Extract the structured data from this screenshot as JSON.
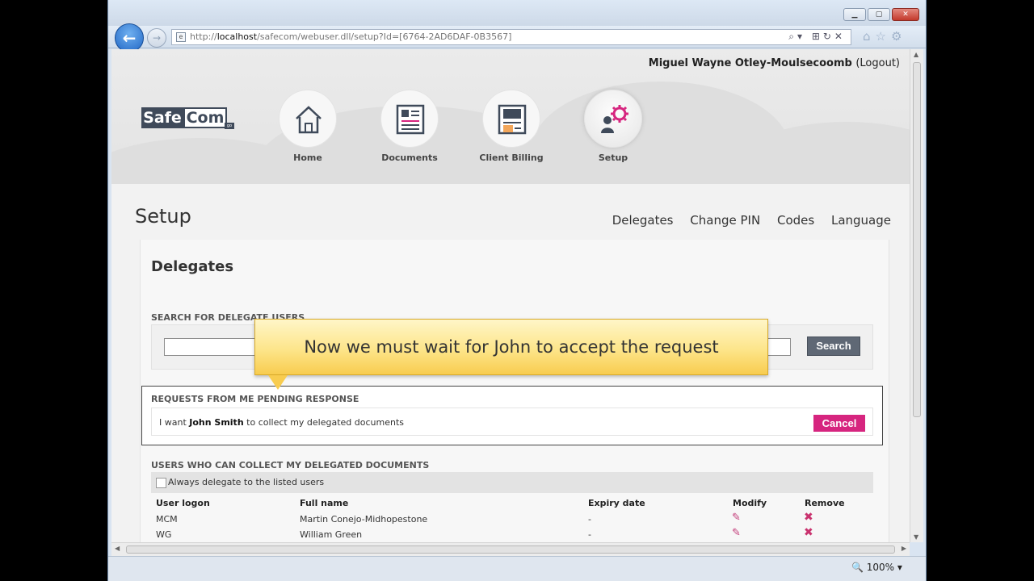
{
  "browser": {
    "url_prefix": "http://",
    "url_host": "localhost",
    "url_path": "/safecom/webuser.dll/setup?Id=[6764-2AD6DAF-0B3567]",
    "zoom": "100%",
    "address_tools": "⌕▾ ⊞↻✕",
    "chrome_icons": "⌂☆⚙"
  },
  "header": {
    "user_name": "Miguel Wayne Otley-Moulsecoomb",
    "logout": "(Logout)"
  },
  "logo": {
    "part1": "Safe",
    "part2": "Com",
    "badge": "go"
  },
  "nav": {
    "home": "Home",
    "documents": "Documents",
    "client_billing": "Client Billing",
    "setup": "Setup"
  },
  "page": {
    "title": "Setup",
    "subnav": [
      "Delegates",
      "Change PIN",
      "Codes",
      "Language"
    ]
  },
  "delegates": {
    "title": "Delegates",
    "search_label": "SEARCH FOR DELEGATE USERS",
    "search_button": "Search",
    "pending_label": "REQUESTS FROM ME PENDING RESPONSE",
    "pending_pre": "I want ",
    "pending_name": "John Smith",
    "pending_post": " to collect my delegated documents",
    "cancel_button": "Cancel",
    "users_label": "USERS WHO CAN COLLECT MY DELEGATED DOCUMENTS",
    "always_label": "Always delegate to the listed users",
    "columns": [
      "User logon",
      "Full name",
      "Expiry date",
      "Modify",
      "Remove"
    ],
    "rows": [
      {
        "logon": "MCM",
        "name": "Martin Conejo-Midhopestone",
        "expiry": "-"
      },
      {
        "logon": "WG",
        "name": "William Green",
        "expiry": "-"
      }
    ]
  },
  "callout": {
    "text": "Now we must wait for John to accept the request"
  },
  "colors": {
    "accent": "#d6257f",
    "button_dark": "#5f6875",
    "callout": "#fde58a"
  }
}
